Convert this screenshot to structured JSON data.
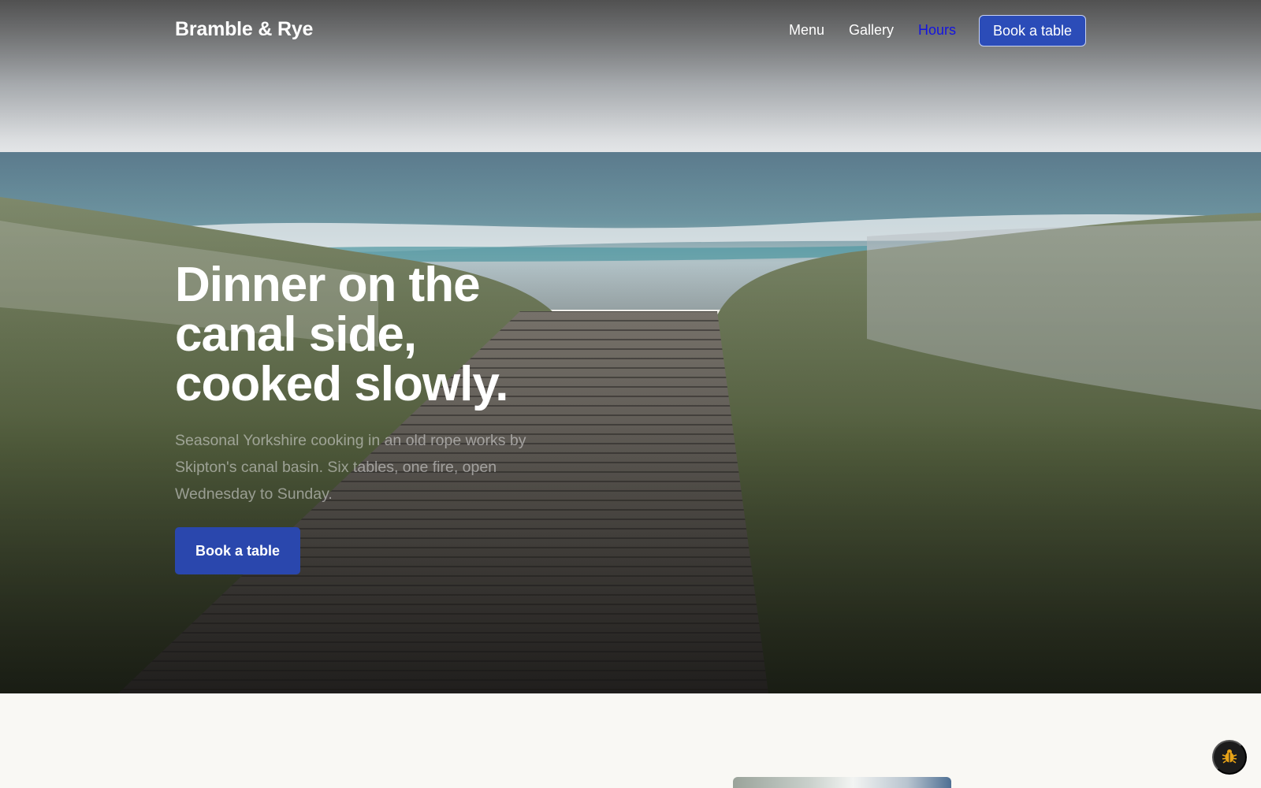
{
  "header": {
    "brand": "Bramble & Rye",
    "nav": [
      {
        "label": "Menu"
      },
      {
        "label": "Gallery"
      },
      {
        "label": "Hours"
      }
    ],
    "active_nav": "Hours",
    "cta_label": "Book a table"
  },
  "hero": {
    "headline_lines": [
      "Dinner on the",
      "canal side,",
      "cooked slowly."
    ],
    "subtext": "Seasonal Yorkshire cooking in an old rope works by Skipton's canal basin. Six tables, one fire, open Wednesday to Sunday.",
    "cta_label": "Book a table"
  },
  "floating": {
    "icon": "bug-icon"
  },
  "colors": {
    "accent": "#2b4cb8",
    "active_link": "#1414e0",
    "page_bg": "#f9f8f4"
  }
}
